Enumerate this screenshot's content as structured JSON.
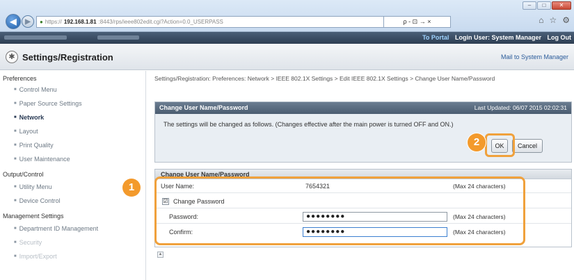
{
  "browser": {
    "window_controls": [
      "–",
      "□",
      "✕"
    ],
    "address_scheme": "https://",
    "address_host": "192.168.1.81",
    "address_rest": ":8443/rps/ieee802edit.cgi?Action=0.0_USERPASS",
    "address_tools": "ρ - ⊡ → ×",
    "right_icons": [
      "⌂",
      "☆",
      "⚙"
    ]
  },
  "portal": {
    "to_portal": "To Portal",
    "login_user": "Login User: System Manager",
    "logout": "Log Out"
  },
  "title": {
    "app_title": "Settings/Registration",
    "mail_link": "Mail to System Manager"
  },
  "sidebar": {
    "preferences": "Preferences",
    "control_menu": "Control Menu",
    "paper_source": "Paper Source Settings",
    "network": "Network",
    "layout": "Layout",
    "print_quality": "Print Quality",
    "user_maintenance": "User Maintenance",
    "output_control": "Output/Control",
    "utility_menu": "Utility Menu",
    "device_control": "Device Control",
    "management_settings": "Management Settings",
    "department_id": "Department ID Management",
    "security": "Security",
    "import_export": "Import/Export"
  },
  "main": {
    "breadcrumb": "Settings/Registration: Preferences: Network > IEEE 802.1X Settings > Edit IEEE 802.1X Settings > Change User Name/Password",
    "confirm_panel": {
      "title": "Change User Name/Password",
      "last_updated": "Last Updated: 06/07 2015 02:02:31",
      "message": "The settings will be changed as follows. (Changes effective after the main power is turned OFF and ON.)",
      "ok_label": "OK",
      "cancel_label": "Cancel"
    },
    "form_panel": {
      "title": "Change User Name/Password",
      "user_name_label": "User Name:",
      "user_name_value": "7654321",
      "user_name_hint": "(Max 24 characters)",
      "change_password_label": "Change Password",
      "change_password_checked": "☑",
      "password_label": "Password:",
      "password_value": "●●●●●●●●",
      "password_hint": "(Max 24 characters)",
      "confirm_label": "Confirm:",
      "confirm_value": "●●●●●●●●",
      "confirm_hint": "(Max 24 characters)"
    },
    "callouts": {
      "one": "1",
      "two": "2"
    },
    "top_icon": "▲"
  },
  "colors": {
    "accent_orange": "#f0a13c",
    "portal_bar": "#2d3e53",
    "panel_header": "#4a5c70"
  }
}
